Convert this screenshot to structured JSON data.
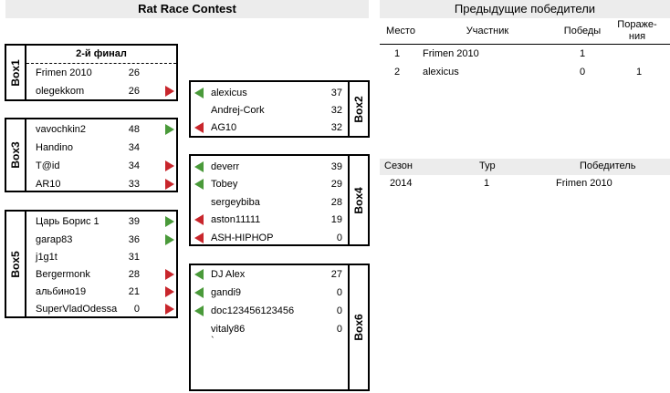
{
  "title": "Rat Race Contest",
  "box1": {
    "label": "Box1",
    "subtitle": "2-й финал",
    "players": [
      {
        "name": "Frimen 2010",
        "score": "26",
        "arrow": ""
      },
      {
        "name": "olegekkom",
        "score": "26",
        "arrow": "red-right"
      }
    ]
  },
  "box3": {
    "label": "Box3",
    "players": [
      {
        "name": "vavochkin2",
        "score": "48",
        "arrow": "green-right"
      },
      {
        "name": "Handino",
        "score": "34",
        "arrow": ""
      },
      {
        "name": "T@id",
        "score": "34",
        "arrow": "red-right"
      },
      {
        "name": "AR10",
        "score": "33",
        "arrow": "red-right"
      }
    ]
  },
  "box5": {
    "label": "Box5",
    "players": [
      {
        "name": "Царь Борис 1",
        "score": "39",
        "arrow": "green-right"
      },
      {
        "name": "garap83",
        "score": "36",
        "arrow": "green-right"
      },
      {
        "name": "j1g1t",
        "score": "31",
        "arrow": ""
      },
      {
        "name": "Bergermonk",
        "score": "28",
        "arrow": "red-right"
      },
      {
        "name": "альбино19",
        "score": "21",
        "arrow": "red-right"
      },
      {
        "name": "SuperVladOdessa",
        "score": "0",
        "arrow": "red-right"
      }
    ]
  },
  "box2": {
    "label": "Box2",
    "players": [
      {
        "name": "alexicus",
        "score": "37",
        "arrow": "green-left"
      },
      {
        "name": "Andrej-Cork",
        "score": "32",
        "arrow": ""
      },
      {
        "name": "AG10",
        "score": "32",
        "arrow": "red-left"
      }
    ]
  },
  "box4": {
    "label": "Box4",
    "players": [
      {
        "name": "deverr",
        "score": "39",
        "arrow": "green-left"
      },
      {
        "name": "Tobey",
        "score": "29",
        "arrow": "green-left"
      },
      {
        "name": "sergeybiba",
        "score": "28",
        "arrow": ""
      },
      {
        "name": "aston11111",
        "score": "19",
        "arrow": "red-left"
      },
      {
        "name": "ASH-HIPHOP",
        "score": "0",
        "arrow": "red-left"
      }
    ]
  },
  "box6": {
    "label": "Box6",
    "players": [
      {
        "name": "DJ Alex",
        "score": "27",
        "arrow": "green-left"
      },
      {
        "name": "gandi9",
        "score": "0",
        "arrow": "green-left"
      },
      {
        "name": "doc123456123456",
        "score": "0",
        "arrow": "green-left"
      },
      {
        "name": "vitaly86",
        "score": "0",
        "arrow": ""
      }
    ],
    "extra": "`"
  },
  "winners": {
    "title": "Предыдущие победители",
    "headers": {
      "place": "Место",
      "participant": "Участник",
      "wins": "Победы",
      "losses_1": "Пораже-",
      "losses_2": "ния"
    },
    "rows": [
      {
        "place": "1",
        "name": "Frimen 2010",
        "wins": "1",
        "losses": ""
      },
      {
        "place": "2",
        "name": "alexicus",
        "wins": "0",
        "losses": "1"
      }
    ]
  },
  "seasons": {
    "headers": {
      "season": "Сезон",
      "round": "Тур",
      "winner": "Победитель"
    },
    "rows": [
      {
        "season": "2014",
        "round": "1",
        "winner": "Frimen 2010"
      }
    ]
  },
  "colors": {
    "header_bg": "#ececec",
    "green": "#4a9a3a",
    "red": "#c8262c"
  }
}
